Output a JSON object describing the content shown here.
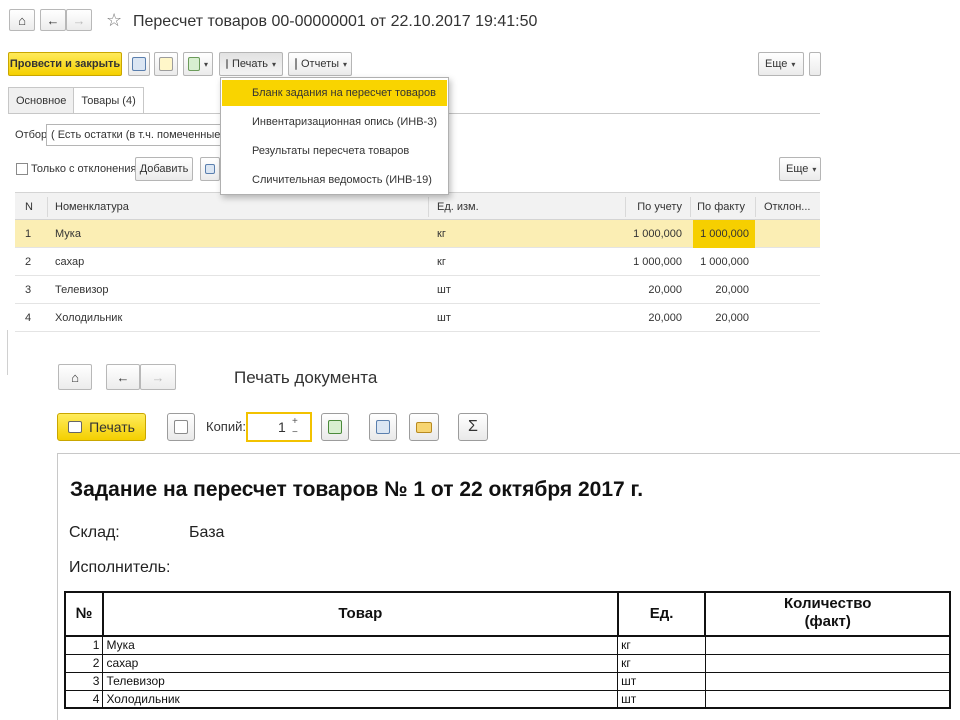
{
  "form": {
    "title": "Пересчет товаров 00-00000001 от 22.10.2017 19:41:50",
    "toolbar": {
      "post_close": "Провести и закрыть",
      "print": "Печать",
      "reports": "Отчеты",
      "more": "Еще"
    },
    "tabs": [
      {
        "label": "Основное"
      },
      {
        "label": "Товары (4)"
      }
    ],
    "filter": {
      "label": "Отбор:",
      "value": "( Есть остатки (в т.ч. помеченные на уда"
    },
    "only_deviations": "Только с отклонениями",
    "add_button": "Добавить",
    "more2": "Еще",
    "grid": {
      "columns": [
        "N",
        "Номенклатура",
        "Ед. изм.",
        "По учету",
        "По факту",
        "Отклон..."
      ],
      "rows": [
        {
          "n": "1",
          "name": "Мука",
          "unit": "кг",
          "book": "1 000,000",
          "fact": "1 000,000"
        },
        {
          "n": "2",
          "name": "сахар",
          "unit": "кг",
          "book": "1 000,000",
          "fact": "1 000,000"
        },
        {
          "n": "3",
          "name": "Телевизор",
          "unit": "шт",
          "book": "20,000",
          "fact": "20,000"
        },
        {
          "n": "4",
          "name": "Холодильник",
          "unit": "шт",
          "book": "20,000",
          "fact": "20,000"
        }
      ]
    },
    "print_menu": [
      {
        "label": "Бланк задания на пересчет товаров"
      },
      {
        "label": "Инвентаризационная опись (ИНВ-3)"
      },
      {
        "label": "Результаты пересчета товаров"
      },
      {
        "label": "Сличительная ведомость (ИНВ-19)"
      }
    ]
  },
  "preview": {
    "title": "Печать документа",
    "print_button": "Печать",
    "copies_label": "Копий:",
    "copies_value": "1",
    "sum_icon": "Σ",
    "document": {
      "heading": "Задание на пересчет товаров № 1 от 22 октября 2017 г.",
      "warehouse_label": "Склад:",
      "warehouse_value": "База",
      "executor_label": "Исполнитель:",
      "columns": {
        "num": "№",
        "item": "Товар",
        "unit": "Ед.",
        "qty_line1": "Количество",
        "qty_line2": "(факт)"
      },
      "rows": [
        {
          "n": "1",
          "item": "Мука",
          "unit": "кг"
        },
        {
          "n": "2",
          "item": "сахар",
          "unit": "кг"
        },
        {
          "n": "3",
          "item": "Телевизор",
          "unit": "шт"
        },
        {
          "n": "4",
          "item": "Холодильник",
          "unit": "шт"
        }
      ]
    }
  },
  "colors": {
    "accent_yellow": "#f5d000",
    "selected_row": "#fbeeb4"
  }
}
